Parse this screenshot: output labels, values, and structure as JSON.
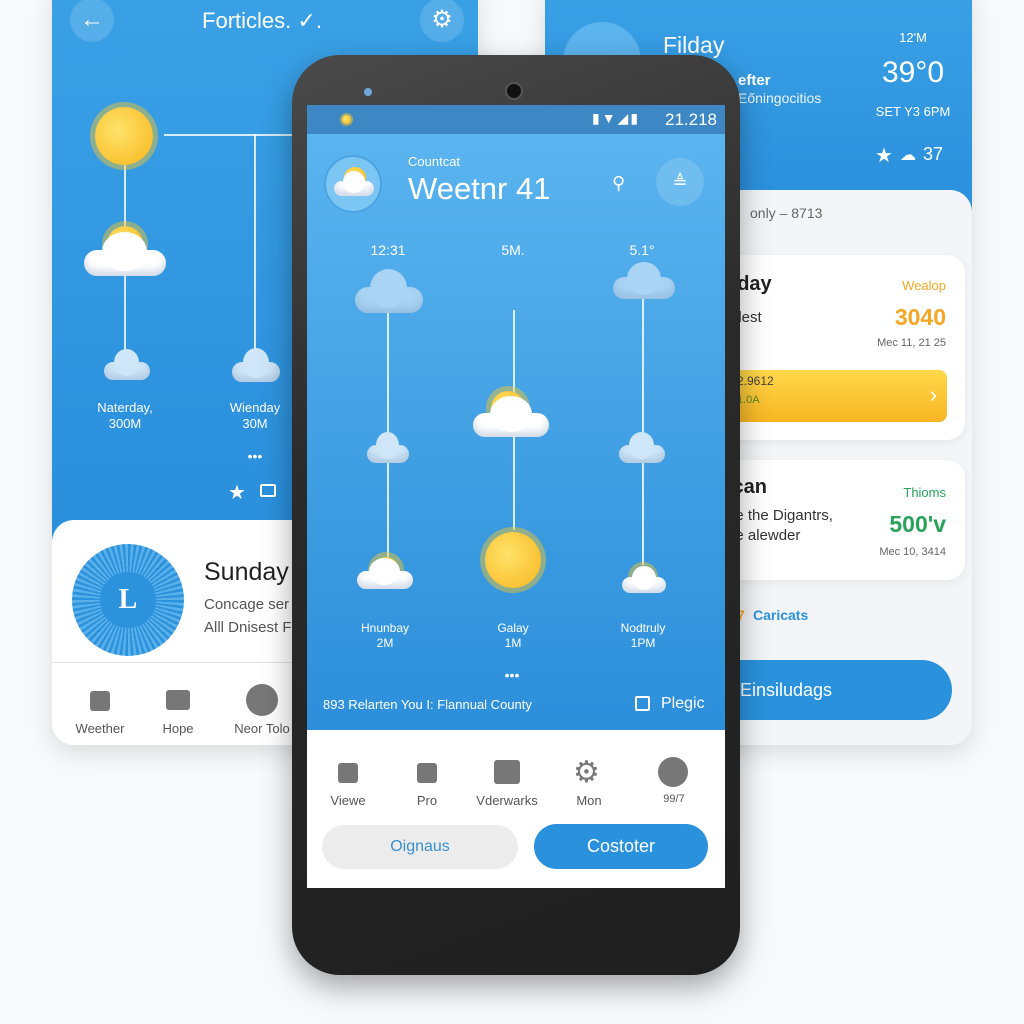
{
  "left_card": {
    "title": "Forticles. ✓.",
    "days": [
      {
        "name": "Naterday,",
        "value": "300M"
      },
      {
        "name": "Wienday",
        "value": "30M"
      }
    ],
    "more": "•••",
    "profile": {
      "initial": "L",
      "title": "Sunday",
      "line1": "Concage ser",
      "line2": "Alll Dnisest F"
    },
    "nav": [
      "Weether",
      "Hope",
      "Neor Tolo"
    ]
  },
  "right_card": {
    "day": "Filday",
    "sub1": "efter",
    "sub2": "Eőningocitios",
    "time": "12'M",
    "temp": "39°0",
    "sunset": "SET Y3 6PM",
    "badge": "37",
    "list_header": "only – 8713",
    "item1": {
      "title": "nday",
      "desc": "ndest",
      "tag": "Wealop",
      "value": "3040",
      "date": "Mec 11, 21 25",
      "bar_value": "2.9612",
      "bar_sub": "1.0A"
    },
    "item2": {
      "title": "ican",
      "desc1": "ue the Digantrs,",
      "desc2": "be alewder",
      "tag": "Thioms",
      "value": "500'v",
      "date": "Mec 10, 3414"
    },
    "link": "Caricats",
    "button": "Einsiludags"
  },
  "phone": {
    "status_time": "21.218",
    "header_sub": "Countcat",
    "header_title": "Weetnr 41",
    "columns": [
      {
        "top": "12:31",
        "name": "Hnunbay",
        "value": "2M"
      },
      {
        "top": "5M.",
        "name": "Galay",
        "value": "1M"
      },
      {
        "top": "5.1°",
        "name": "Nodtruly",
        "value": "1PM"
      }
    ],
    "more": "•••",
    "footer_text": "893 Relarten You I: Flannual County",
    "footer_action": "Plegic",
    "nav": [
      "Viewe",
      "Pro",
      "Vderwarks",
      "Mon",
      "99/7"
    ],
    "secondary_button": "Oignaus",
    "primary_button": "Costoter"
  },
  "colors": {
    "primary": "#2a92dd",
    "warning": "#f5a623",
    "success": "#27a35a"
  }
}
